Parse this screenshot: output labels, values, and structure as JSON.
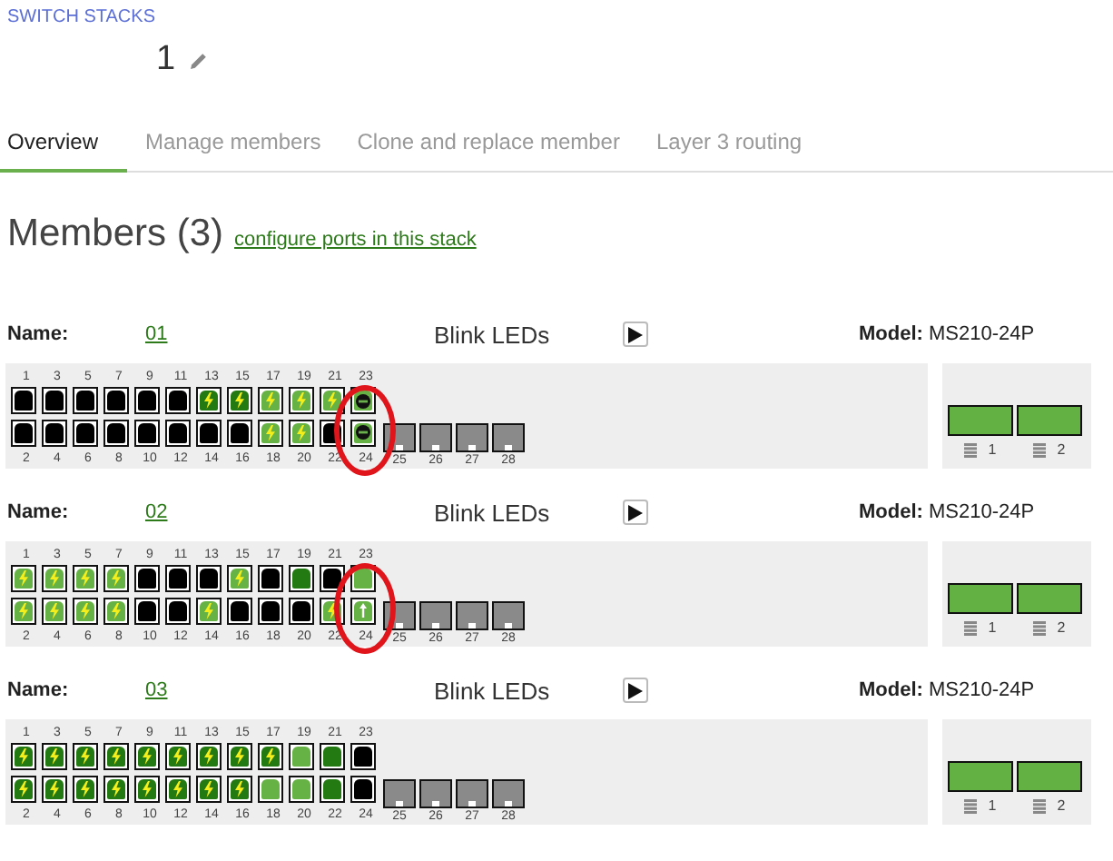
{
  "breadcrumb": "SWITCH STACKS",
  "stack_name": "1",
  "tabs": [
    {
      "label": "Overview",
      "selected": true
    },
    {
      "label": "Manage members",
      "selected": false
    },
    {
      "label": "Clone and replace member",
      "selected": false
    },
    {
      "label": "Layer 3 routing",
      "selected": false
    }
  ],
  "members_heading": "Members (3)",
  "configure_link": "configure ports in this stack",
  "members": [
    {
      "name_label": "Name:",
      "name": "01",
      "blink_label": "Blink LEDs",
      "model_label": "Model:",
      "model": "MS210-24P",
      "circled": true,
      "top_ports": [
        {
          "number": "1",
          "color": "#000000",
          "kind": "plain"
        },
        {
          "number": "3",
          "color": "#000000",
          "kind": "plain"
        },
        {
          "number": "5",
          "color": "#000000",
          "kind": "plain"
        },
        {
          "number": "7",
          "color": "#000000",
          "kind": "plain"
        },
        {
          "number": "9",
          "color": "#000000",
          "kind": "plain"
        },
        {
          "number": "11",
          "color": "#000000",
          "kind": "plain"
        },
        {
          "number": "13",
          "color": "#237a12",
          "kind": "poe"
        },
        {
          "number": "15",
          "color": "#237a12",
          "kind": "poe"
        },
        {
          "number": "17",
          "color": "#67b244",
          "kind": "poe"
        },
        {
          "number": "19",
          "color": "#67b244",
          "kind": "poe"
        },
        {
          "number": "21",
          "color": "#67b244",
          "kind": "poe"
        },
        {
          "number": "23",
          "color": "#67b244",
          "kind": "blocked"
        }
      ],
      "bottom_ports": [
        {
          "number": "2",
          "color": "#000000",
          "kind": "plain"
        },
        {
          "number": "4",
          "color": "#000000",
          "kind": "plain"
        },
        {
          "number": "6",
          "color": "#000000",
          "kind": "plain"
        },
        {
          "number": "8",
          "color": "#000000",
          "kind": "plain"
        },
        {
          "number": "10",
          "color": "#000000",
          "kind": "plain"
        },
        {
          "number": "12",
          "color": "#000000",
          "kind": "plain"
        },
        {
          "number": "14",
          "color": "#000000",
          "kind": "plain"
        },
        {
          "number": "16",
          "color": "#000000",
          "kind": "plain"
        },
        {
          "number": "18",
          "color": "#67b244",
          "kind": "poe"
        },
        {
          "number": "20",
          "color": "#67b244",
          "kind": "poe"
        },
        {
          "number": "22",
          "color": "#000000",
          "kind": "plain"
        },
        {
          "number": "24",
          "color": "#67b244",
          "kind": "blocked"
        }
      ],
      "sfp_ports": [
        "25",
        "26",
        "27",
        "28"
      ],
      "power_supplies": [
        "1",
        "2"
      ]
    },
    {
      "name_label": "Name:",
      "name": "02",
      "blink_label": "Blink LEDs",
      "model_label": "Model:",
      "model": "MS210-24P",
      "circled": true,
      "top_ports": [
        {
          "number": "1",
          "color": "#67b244",
          "kind": "poe"
        },
        {
          "number": "3",
          "color": "#67b244",
          "kind": "poe"
        },
        {
          "number": "5",
          "color": "#67b244",
          "kind": "poe"
        },
        {
          "number": "7",
          "color": "#67b244",
          "kind": "poe"
        },
        {
          "number": "9",
          "color": "#000000",
          "kind": "plain"
        },
        {
          "number": "11",
          "color": "#000000",
          "kind": "plain"
        },
        {
          "number": "13",
          "color": "#000000",
          "kind": "plain"
        },
        {
          "number": "15",
          "color": "#67b244",
          "kind": "poe"
        },
        {
          "number": "17",
          "color": "#000000",
          "kind": "plain"
        },
        {
          "number": "19",
          "color": "#237a12",
          "kind": "plain"
        },
        {
          "number": "21",
          "color": "#000000",
          "kind": "plain"
        },
        {
          "number": "23",
          "color": "#67b244",
          "kind": "plain"
        }
      ],
      "bottom_ports": [
        {
          "number": "2",
          "color": "#67b244",
          "kind": "poe"
        },
        {
          "number": "4",
          "color": "#67b244",
          "kind": "poe"
        },
        {
          "number": "6",
          "color": "#67b244",
          "kind": "poe"
        },
        {
          "number": "8",
          "color": "#67b244",
          "kind": "poe"
        },
        {
          "number": "10",
          "color": "#000000",
          "kind": "plain"
        },
        {
          "number": "12",
          "color": "#000000",
          "kind": "plain"
        },
        {
          "number": "14",
          "color": "#67b244",
          "kind": "poe"
        },
        {
          "number": "16",
          "color": "#000000",
          "kind": "plain"
        },
        {
          "number": "18",
          "color": "#000000",
          "kind": "plain"
        },
        {
          "number": "20",
          "color": "#000000",
          "kind": "plain"
        },
        {
          "number": "22",
          "color": "#67b244",
          "kind": "poe"
        },
        {
          "number": "24",
          "color": "#67b244",
          "kind": "uplink"
        }
      ],
      "sfp_ports": [
        "25",
        "26",
        "27",
        "28"
      ],
      "power_supplies": [
        "1",
        "2"
      ]
    },
    {
      "name_label": "Name:",
      "name": "03",
      "blink_label": "Blink LEDs",
      "model_label": "Model:",
      "model": "MS210-24P",
      "circled": false,
      "top_ports": [
        {
          "number": "1",
          "color": "#237a12",
          "kind": "poe"
        },
        {
          "number": "3",
          "color": "#237a12",
          "kind": "poe"
        },
        {
          "number": "5",
          "color": "#237a12",
          "kind": "poe"
        },
        {
          "number": "7",
          "color": "#237a12",
          "kind": "poe"
        },
        {
          "number": "9",
          "color": "#237a12",
          "kind": "poe"
        },
        {
          "number": "11",
          "color": "#237a12",
          "kind": "poe"
        },
        {
          "number": "13",
          "color": "#237a12",
          "kind": "poe"
        },
        {
          "number": "15",
          "color": "#237a12",
          "kind": "poe"
        },
        {
          "number": "17",
          "color": "#237a12",
          "kind": "poe"
        },
        {
          "number": "19",
          "color": "#67b244",
          "kind": "plain"
        },
        {
          "number": "21",
          "color": "#237a12",
          "kind": "plain"
        },
        {
          "number": "23",
          "color": "#000000",
          "kind": "plain"
        }
      ],
      "bottom_ports": [
        {
          "number": "2",
          "color": "#237a12",
          "kind": "poe"
        },
        {
          "number": "4",
          "color": "#237a12",
          "kind": "poe"
        },
        {
          "number": "6",
          "color": "#237a12",
          "kind": "poe"
        },
        {
          "number": "8",
          "color": "#237a12",
          "kind": "poe"
        },
        {
          "number": "10",
          "color": "#237a12",
          "kind": "poe"
        },
        {
          "number": "12",
          "color": "#237a12",
          "kind": "poe"
        },
        {
          "number": "14",
          "color": "#237a12",
          "kind": "poe"
        },
        {
          "number": "16",
          "color": "#237a12",
          "kind": "poe"
        },
        {
          "number": "18",
          "color": "#67b244",
          "kind": "plain"
        },
        {
          "number": "20",
          "color": "#67b244",
          "kind": "plain"
        },
        {
          "number": "22",
          "color": "#237a12",
          "kind": "plain"
        },
        {
          "number": "24",
          "color": "#000000",
          "kind": "plain"
        }
      ],
      "sfp_ports": [
        "25",
        "26",
        "27",
        "28"
      ],
      "power_supplies": [
        "1",
        "2"
      ]
    }
  ]
}
